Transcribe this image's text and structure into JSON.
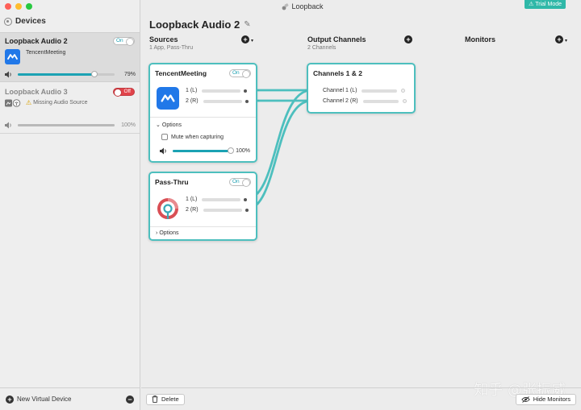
{
  "window": {
    "title": "Loopback",
    "trial_badge": "Trial Mode"
  },
  "sidebar": {
    "header": "Devices",
    "devices": [
      {
        "name": "Loopback Audio 2",
        "toggle": "On",
        "app_label": "TencentMeeting",
        "volume_label": "79%",
        "volume": 0.79,
        "selected": true
      },
      {
        "name": "Loopback Audio 3",
        "toggle": "Off",
        "warning": "Missing Audio Source",
        "volume_label": "100%",
        "volume": 1.0,
        "selected": false
      }
    ],
    "footer": {
      "new_device": "New Virtual Device"
    }
  },
  "main": {
    "device_title": "Loopback Audio 2",
    "columns": {
      "sources": {
        "title": "Sources",
        "subtitle": "1 App, Pass-Thru"
      },
      "outputs": {
        "title": "Output Channels",
        "subtitle": "2 Channels"
      },
      "monitors": {
        "title": "Monitors"
      }
    },
    "sources": [
      {
        "name": "TencentMeeting",
        "toggle": "On",
        "channels": [
          "1 (L)",
          "2 (R)"
        ],
        "options_label": "Options",
        "mute_label": "Mute when capturing",
        "volume_label": "100%",
        "volume": 1.0,
        "expanded": true
      },
      {
        "name": "Pass-Thru",
        "toggle": "On",
        "channels": [
          "1 (L)",
          "2 (R)"
        ],
        "options_label": "Options",
        "expanded": false
      }
    ],
    "output": {
      "name": "Channels 1 & 2",
      "channels": [
        "Channel 1 (L)",
        "Channel 2 (R)"
      ]
    },
    "footer": {
      "delete": "Delete",
      "hide_monitors": "Hide Monitors"
    }
  },
  "watermark": "知乎 @张振威",
  "colors": {
    "accent": "#4dbfbe",
    "wire": "#4dbfbe",
    "trial": "#2fb8a8",
    "off": "#e1434a",
    "app_icon": "#2178e8"
  }
}
